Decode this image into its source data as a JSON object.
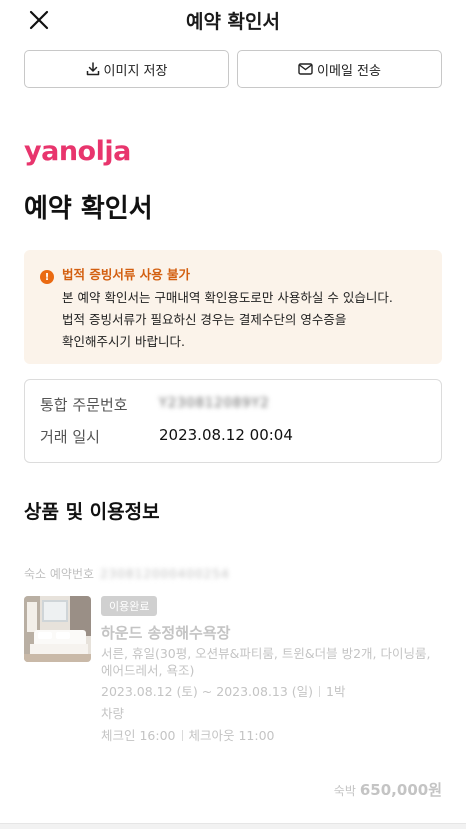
{
  "header": {
    "title": "예약 확인서",
    "close_icon": "close-icon"
  },
  "actions": {
    "save_image": "이미지 저장",
    "send_email": "이메일 전송"
  },
  "brand": {
    "logo": "yanolja",
    "color": "#e8356d"
  },
  "document_title": "예약 확인서",
  "notice": {
    "title": "법적 증빙서류 사용 불가",
    "lines": [
      "본 예약 확인서는 구매내역 확인용도로만 사용하실 수 있습니다.",
      "법적 증빙서류가 필요하신 경우는 결제수단의 영수증을",
      "확인해주시기 바랍니다."
    ],
    "accent": "#d35f10",
    "background": "#fbf3ea"
  },
  "order": {
    "order_no_label": "통합 주문번호",
    "order_no_value": "Y230812089Y2",
    "datetime_label": "거래 일시",
    "datetime_value": "2023.08.12 00:04"
  },
  "section_title": "상품 및 이용정보",
  "booking": {
    "reserve_label": "숙소 예약번호",
    "reserve_value": "230812000400254",
    "status_badge": "이용완료",
    "hotel_name": "하운드 송정해수욕장",
    "room_desc": "서른, 휴일(30평, 오션뷰&파티룸, 트윈&더블 방2개, 다이닝룸, 에어드레서, 욕조)",
    "check_in_date": "2023.08.12 (토)",
    "date_sep": "~",
    "check_out_date": "2023.08.13 (일)",
    "nights": "1박",
    "vehicle": "차량",
    "check_in": "체크인 16:00",
    "check_out": "체크아웃 11:00",
    "price_label": "숙박",
    "price_value": "650,000원"
  }
}
